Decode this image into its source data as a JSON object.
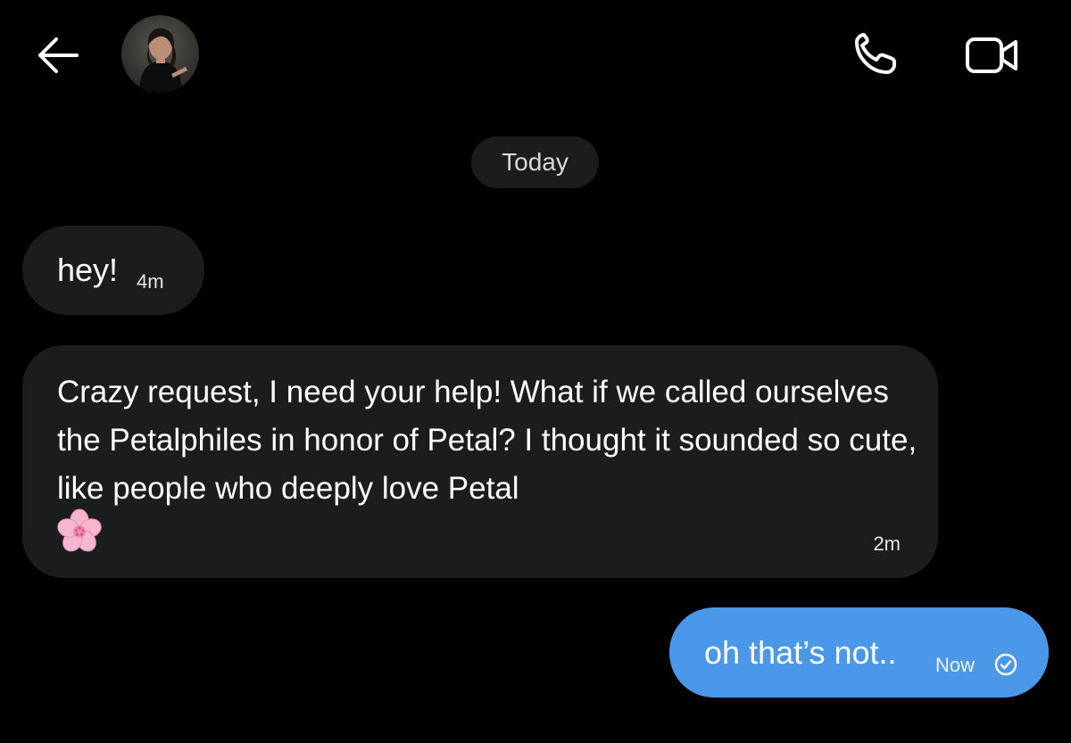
{
  "header": {
    "back_icon": "arrow-left-icon",
    "avatar_alt": "contact-avatar",
    "call_icon": "phone-icon",
    "video_icon": "video-camera-icon"
  },
  "conversation": {
    "date_separator": "Today",
    "messages": [
      {
        "direction": "incoming",
        "text": "hey!",
        "time": "4m"
      },
      {
        "direction": "incoming",
        "text": "Crazy request, I need your help! What if we called ourselves the Petalphiles in honor of Petal? I thought it sounded so cute, like people who deeply love Petal",
        "emoji": "cherry-blossom-icon",
        "time": "2m"
      },
      {
        "direction": "outgoing",
        "text": "oh that’s not..",
        "time": "Now",
        "status_icon": "check-circle-icon"
      }
    ]
  },
  "colors": {
    "background": "#000000",
    "incoming_bubble": "#1b1c1e",
    "outgoing_bubble": "#4b98e9",
    "text": "#ffffff"
  }
}
